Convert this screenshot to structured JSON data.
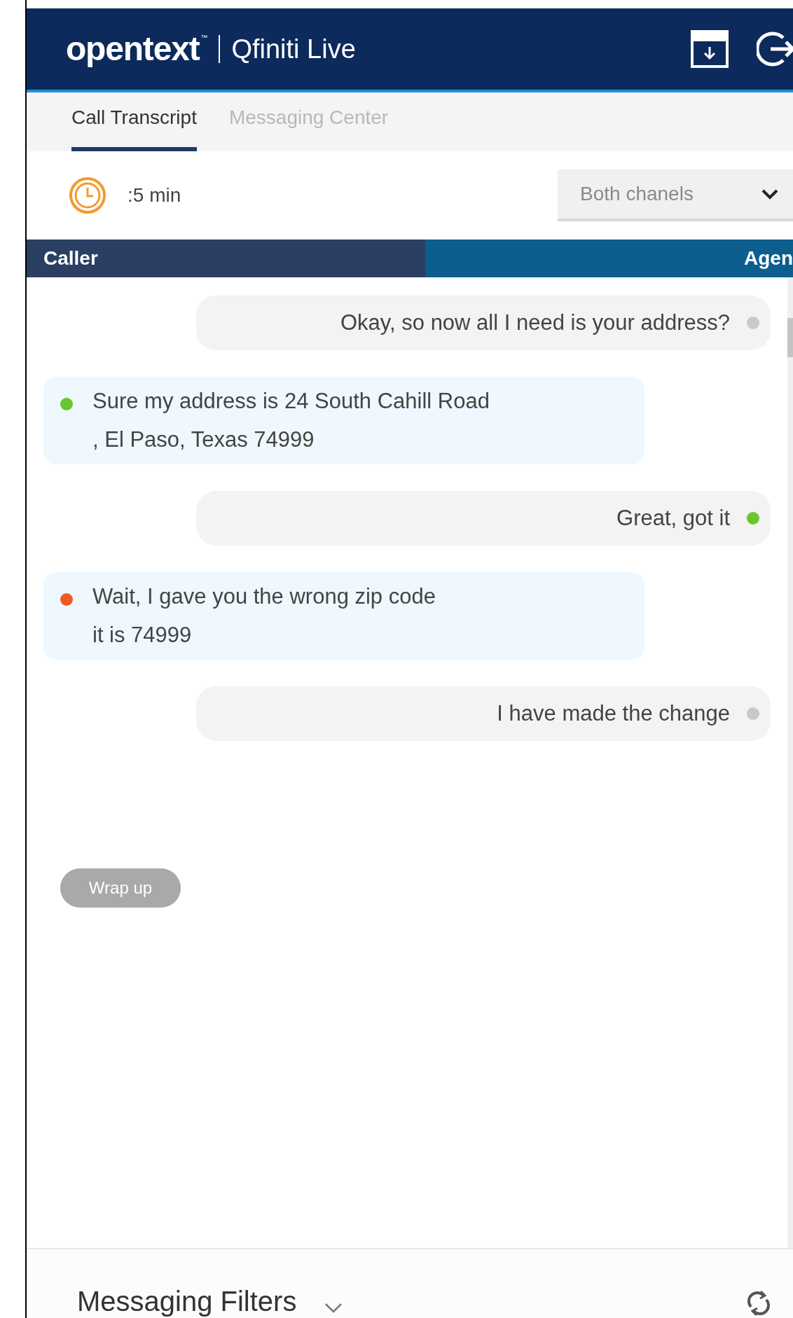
{
  "header": {
    "brand": "opentext",
    "trademark": "™",
    "product": "Qfiniti Live"
  },
  "tabs": [
    {
      "label": "Call Transcript",
      "selected": true
    },
    {
      "label": "Messaging Center",
      "selected": false
    }
  ],
  "timer": {
    "text": ":5 min"
  },
  "channel_select": {
    "value": "Both chanels"
  },
  "speaker_bar": {
    "caller": "Caller",
    "agent": "Agen",
    "level": 0.52
  },
  "messages": [
    {
      "kind": "agent",
      "lines": [
        "Okay, so now all I need is your address?"
      ],
      "color": "#c9c9c9"
    },
    {
      "kind": "caller",
      "lines": [
        "Sure my address is 24 South Cahill Road",
        ", El Paso, Texas 74999"
      ],
      "color": "#6ac62c"
    },
    {
      "kind": "agent",
      "lines": [
        "Great, got it"
      ],
      "color": "#6ac62c"
    },
    {
      "kind": "caller",
      "lines": [
        "Wait, I gave you the wrong zip code",
        "it is 74999"
      ],
      "color": "#f05a22"
    },
    {
      "kind": "agent",
      "lines": [
        "I have made the change"
      ],
      "color": "#c9c9c9"
    }
  ],
  "wrap_up": {
    "label": "Wrap up"
  },
  "footer": {
    "title": "Messaging Filters"
  }
}
